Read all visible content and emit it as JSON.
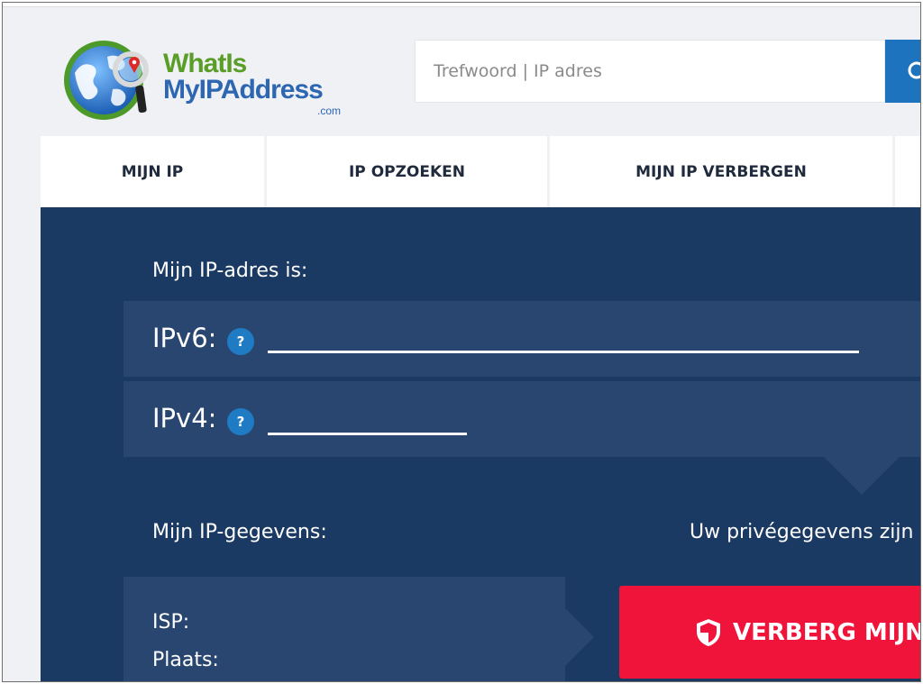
{
  "logo": {
    "line1": "WhatIs",
    "line2": "MyIPAddress",
    "suffix": ".com"
  },
  "search": {
    "placeholder": "Trefwoord | IP adres",
    "button_icon": "search-icon"
  },
  "nav": {
    "items": [
      {
        "label": "MIJN IP"
      },
      {
        "label": "IP OPZOEKEN"
      },
      {
        "label": "MIJN IP VERBERGEN"
      }
    ]
  },
  "main": {
    "ip_heading": "Mijn IP-adres is:",
    "ipv6_label": "IPv6:",
    "ipv4_label": "IPv4:",
    "help_label": "?",
    "details_heading": "Mijn IP-gegevens:",
    "privacy_text": "Uw privégegevens zijn",
    "isp_label": "ISP:",
    "city_label": "Plaats:",
    "hide_button_label": "VERBERG MIJN"
  },
  "colors": {
    "page_bg": "#eff1f4",
    "panel_bg": "#1b3a63",
    "row_bg": "#28466f",
    "accent_blue": "#1e73be",
    "danger_red": "#f0133a",
    "logo_green": "#5a9d27",
    "logo_blue": "#2d66b1"
  }
}
